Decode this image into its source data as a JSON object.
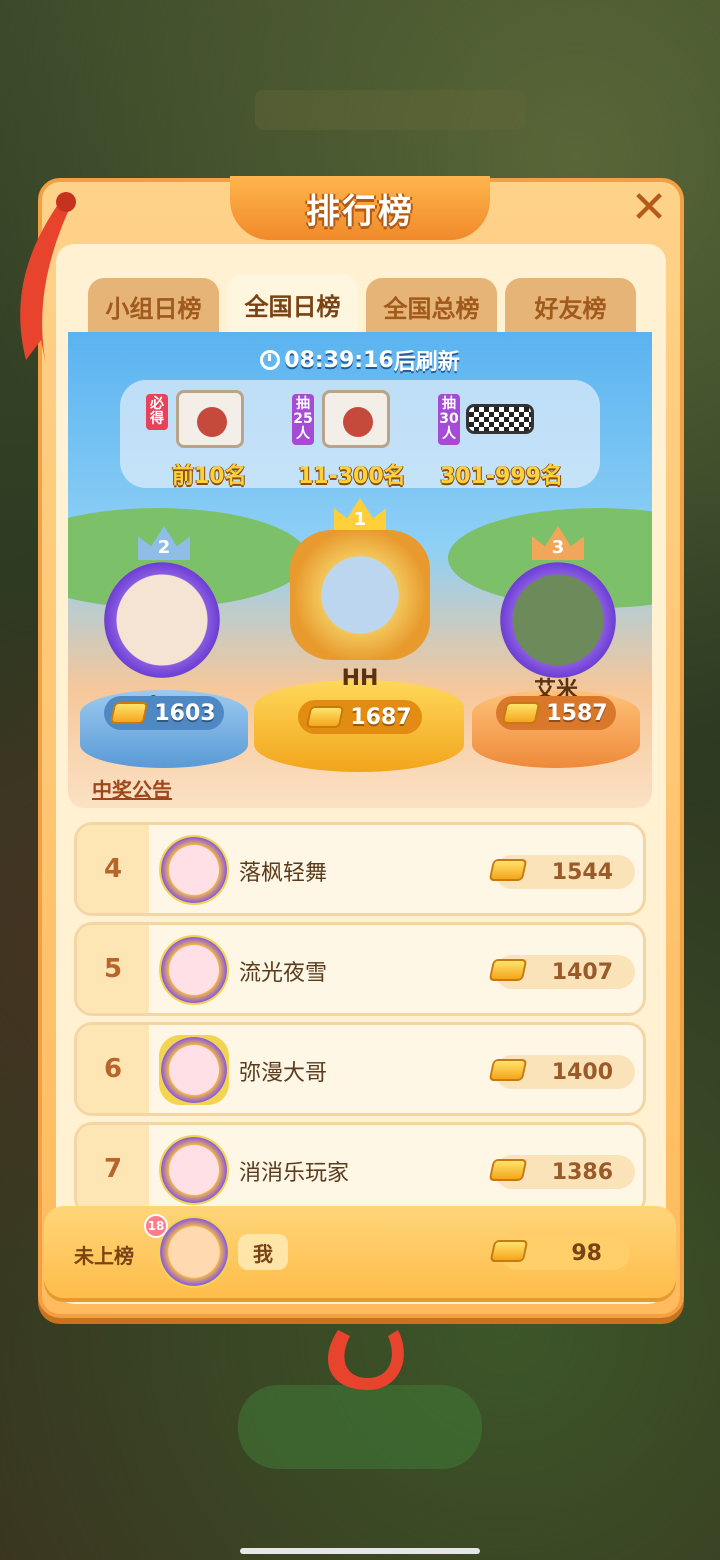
{
  "title": "排行榜",
  "tabs": [
    {
      "label": "小组日榜",
      "active": false
    },
    {
      "label": "全国日榜",
      "active": true
    },
    {
      "label": "全国总榜",
      "active": false
    },
    {
      "label": "好友榜",
      "active": false
    }
  ],
  "timer": {
    "time": "08:39:16",
    "suffix": "后刷新"
  },
  "prizes": [
    {
      "tag": "必得",
      "label": "前10名",
      "tag_color": "#e8425a"
    },
    {
      "tag": "抽25人",
      "label": "11-300名",
      "tag_color": "#a64bd6"
    },
    {
      "tag": "抽30人",
      "label": "301-999名",
      "tag_color": "#a64bd6"
    }
  ],
  "podium": [
    {
      "rank": "2",
      "name": "。",
      "score": "1603",
      "color": "#6aa9de"
    },
    {
      "rank": "1",
      "name": "HH",
      "score": "1687",
      "color": "#ffb627"
    },
    {
      "rank": "3",
      "name": "艾米",
      "score": "1587",
      "color": "#f39a4e"
    }
  ],
  "notice": "中奖公告",
  "list": [
    {
      "rank": "4",
      "name": "落枫轻舞",
      "score": "1544"
    },
    {
      "rank": "5",
      "name": "流光夜雪",
      "score": "1407"
    },
    {
      "rank": "6",
      "name": "弥漫大哥",
      "score": "1400"
    },
    {
      "rank": "7",
      "name": "消消乐玩家",
      "score": "1386"
    }
  ],
  "me": {
    "status": "未上榜",
    "level": "18",
    "name": "我",
    "score": "98"
  },
  "close_icon": "close-icon",
  "accent": "#f08a2a"
}
